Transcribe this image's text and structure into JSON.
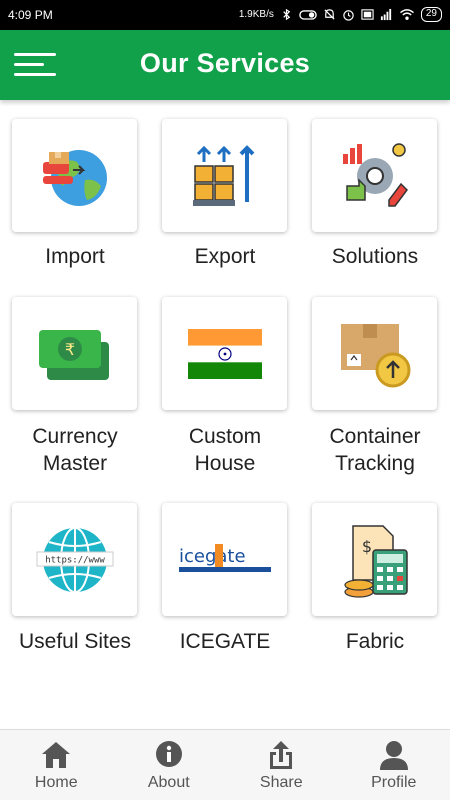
{
  "status_bar": {
    "time": "4:09 PM",
    "net_speed": "1.9KB/s",
    "battery": "29"
  },
  "app_bar": {
    "title": "Our Services"
  },
  "services": [
    {
      "label": "Import",
      "icon": "import-globe-icon"
    },
    {
      "label": "Export",
      "icon": "export-boxes-icon"
    },
    {
      "label": "Solutions",
      "icon": "solutions-gear-icon"
    },
    {
      "label": "Currency\nMaster",
      "icon": "currency-notes-icon"
    },
    {
      "label": "Custom\nHouse",
      "icon": "india-flag-icon"
    },
    {
      "label": "Container\nTracking",
      "icon": "container-box-icon"
    },
    {
      "label": "Useful Sites",
      "icon": "www-globe-icon"
    },
    {
      "label": "ICEGATE",
      "icon": "icegate-logo"
    },
    {
      "label": "Fabric",
      "icon": "calculator-bill-icon"
    }
  ],
  "icegate_logo_text": "icegate",
  "www_text": "https://www",
  "bottom_nav": [
    {
      "label": "Home",
      "icon": "home-icon"
    },
    {
      "label": "About",
      "icon": "info-icon"
    },
    {
      "label": "Share",
      "icon": "share-icon"
    },
    {
      "label": "Profile",
      "icon": "profile-icon"
    }
  ],
  "colors": {
    "primary": "#12a14b",
    "nav_icon": "#555555"
  }
}
